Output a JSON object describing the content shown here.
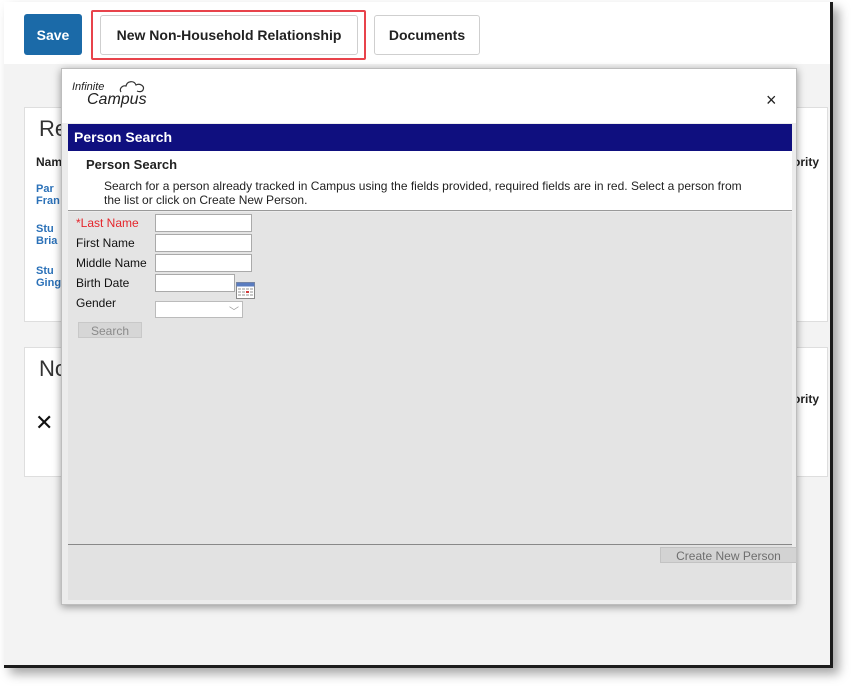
{
  "toolbar": {
    "save_label": "Save",
    "new_relationship_label": "New Non-Household Relationship",
    "documents_label": "Documents"
  },
  "background": {
    "card1": {
      "title": "Re",
      "col_name": "Nam",
      "col_priority": "ority",
      "rows": [
        {
          "line1": "Par",
          "line2": "Fran"
        },
        {
          "line1": "Stu",
          "line2": "Bria"
        },
        {
          "line1": "Stu",
          "line2": "Ging"
        }
      ]
    },
    "card2": {
      "title": "No",
      "col_priority": "ority",
      "remove_symbol": "✕"
    }
  },
  "modal": {
    "logo_line1": "Infinite",
    "logo_line2": "Campus",
    "close_symbol": "×",
    "title": "Person Search",
    "section_title": "Person Search",
    "description": "Search for a person already tracked in Campus using the fields provided, required fields are in red. Select a person from the list or click on Create New Person.",
    "form": {
      "last_name_label": "*Last Name",
      "first_name_label": "First Name",
      "middle_name_label": "Middle Name",
      "birth_date_label": "Birth Date",
      "gender_label": "Gender",
      "last_name_value": "",
      "first_name_value": "",
      "middle_name_value": "",
      "birth_date_value": "",
      "gender_value": "",
      "search_label": "Search"
    },
    "create_label": "Create New Person"
  },
  "colors": {
    "save_button": "#1b6aa8",
    "highlight": "#e8434b",
    "modal_title_bar": "#0f0f7f",
    "required_label": "#e4262c",
    "link": "#2b71b8"
  },
  "icons": [
    "calendar-icon",
    "chevron-down-icon",
    "close-icon",
    "campus-cloud-logo"
  ]
}
